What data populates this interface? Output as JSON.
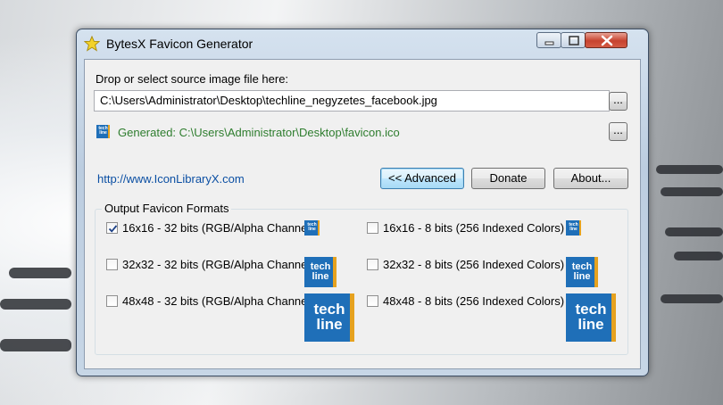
{
  "window": {
    "title": "BytesX Favicon Generator"
  },
  "source": {
    "label": "Drop or select source image file here:",
    "path": "C:\\Users\\Administrator\\Desktop\\techline_negyzetes_facebook.jpg",
    "browse_label": "..."
  },
  "output": {
    "generated_text": "Generated: C:\\Users\\Administrator\\Desktop\\favicon.ico",
    "browse_label": "..."
  },
  "link": "http://www.IconLibraryX.com",
  "buttons": {
    "advanced": "<< Advanced",
    "donate": "Donate",
    "about": "About..."
  },
  "formats": {
    "title": "Output Favicon Formats",
    "items": [
      {
        "label": "16x16 - 32 bits (RGB/Alpha Channel)",
        "checked": true
      },
      {
        "label": "16x16 - 8 bits (256 Indexed Colors)",
        "checked": false
      },
      {
        "label": "32x32 - 32 bits (RGB/Alpha Channel)",
        "checked": false
      },
      {
        "label": "32x32 - 8 bits (256 Indexed Colors)",
        "checked": false
      },
      {
        "label": "48x48 - 32 bits (RGB/Alpha Channel)",
        "checked": false
      },
      {
        "label": "48x48 - 8 bits (256 Indexed Colors)",
        "checked": false
      }
    ],
    "preview_text_top": "tech",
    "preview_text_bottom": "line"
  },
  "colors": {
    "accent": "#1f6fb8",
    "link": "#0b4fa3",
    "success": "#2e7d2e"
  }
}
